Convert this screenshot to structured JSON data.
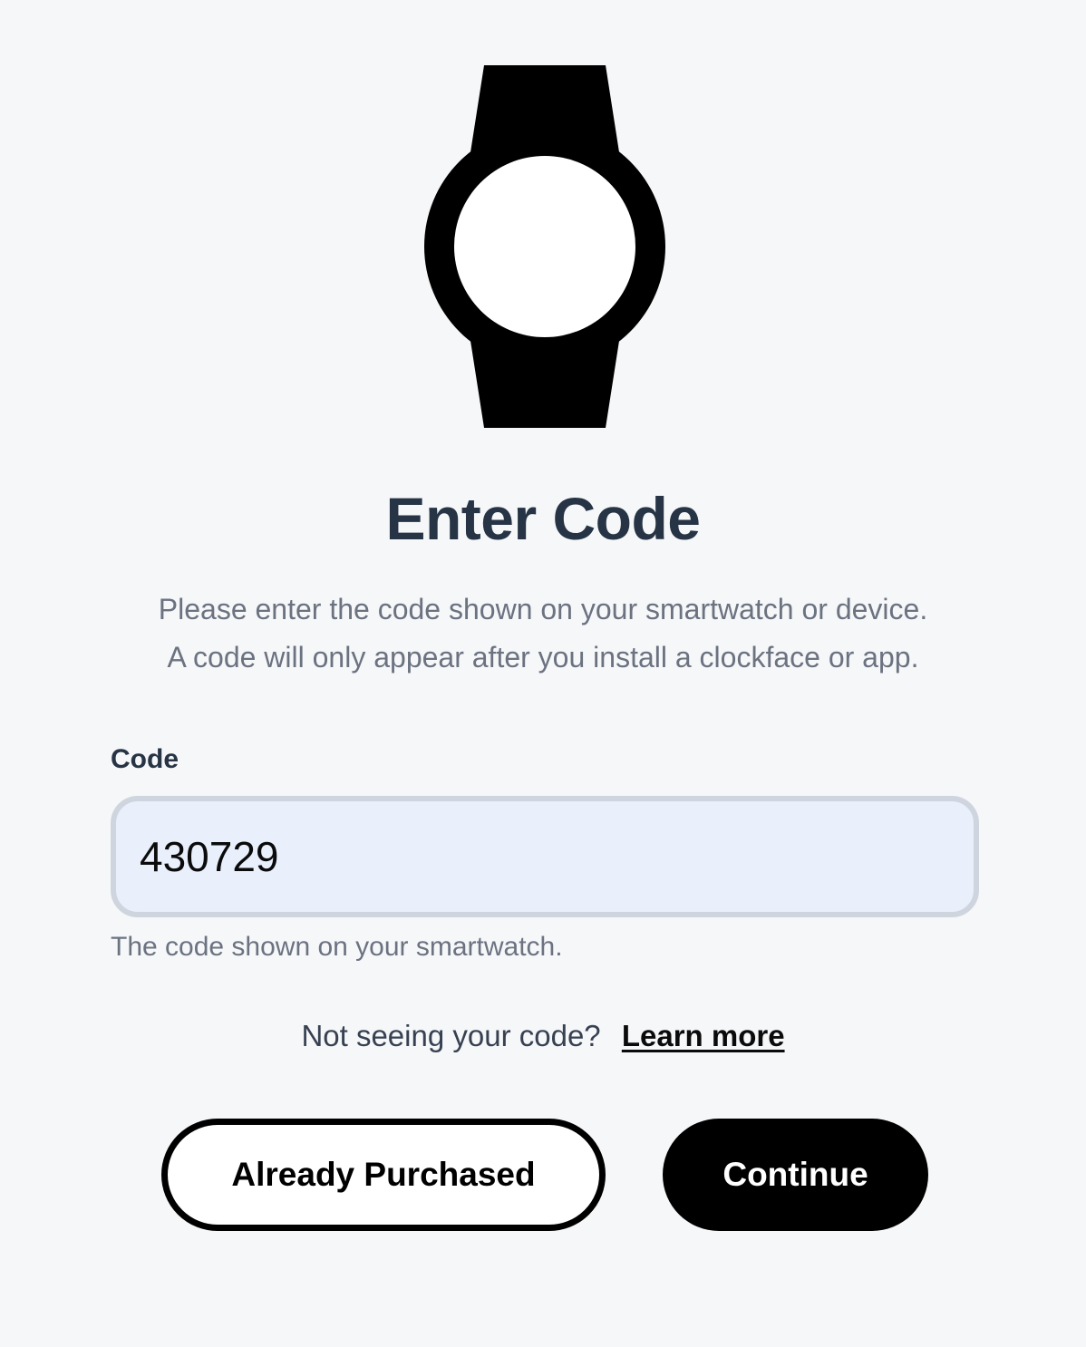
{
  "header": {
    "icon": "smartwatch-icon",
    "title": "Enter Code",
    "description_lines": [
      "Please enter the code shown on your smartwatch or device.",
      "A code will only appear after you install a clockface or app."
    ]
  },
  "form": {
    "code_label": "Code",
    "code_value": "430729",
    "code_helper": "The code shown on your smartwatch."
  },
  "help": {
    "question": "Not seeing your code?",
    "link_label": "Learn more"
  },
  "actions": {
    "already_purchased_label": "Already Purchased",
    "continue_label": "Continue"
  },
  "colors": {
    "background": "#f6f7f9",
    "heading": "#263445",
    "muted_text": "#6b7280",
    "input_background": "#e9effb",
    "input_border": "#cfd5de",
    "primary_button": "#000000"
  }
}
